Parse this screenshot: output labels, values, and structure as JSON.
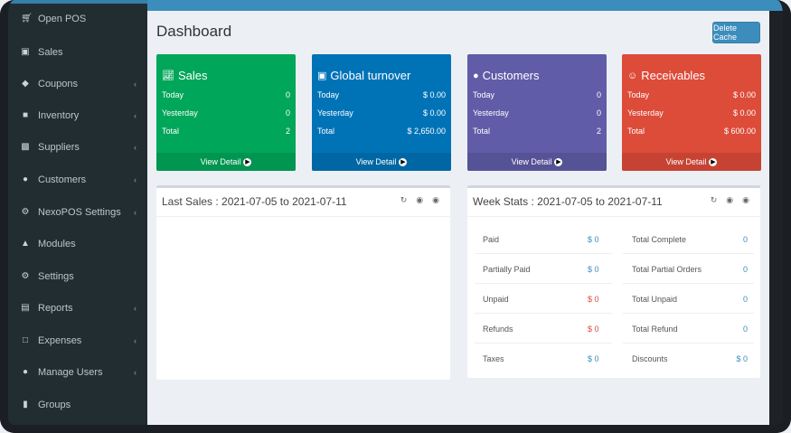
{
  "sidebar": {
    "items": [
      {
        "label": "Open POS",
        "icon": "cart-icon",
        "chevron": false
      },
      {
        "label": "Sales",
        "icon": "basket-icon",
        "chevron": false
      },
      {
        "label": "Coupons",
        "icon": "tag-icon",
        "chevron": true
      },
      {
        "label": "Inventory",
        "icon": "archive-icon",
        "chevron": true
      },
      {
        "label": "Suppliers",
        "icon": "truck-icon",
        "chevron": true
      },
      {
        "label": "Customers",
        "icon": "users-icon",
        "chevron": true
      },
      {
        "label": "NexoPOS Settings",
        "icon": "gear-icon",
        "chevron": true
      },
      {
        "label": "Modules",
        "icon": "puzzle-icon",
        "chevron": false
      },
      {
        "label": "Settings",
        "icon": "cogs-icon",
        "chevron": false
      },
      {
        "label": "Reports",
        "icon": "bar-chart-icon",
        "chevron": true
      },
      {
        "label": "Expenses",
        "icon": "square-icon",
        "chevron": true
      },
      {
        "label": "Manage Users",
        "icon": "users-icon",
        "chevron": true
      },
      {
        "label": "Groups",
        "icon": "shield-icon",
        "chevron": false
      }
    ]
  },
  "header": {
    "title": "Dashboard",
    "delete_cache": "Delete Cache"
  },
  "cards": [
    {
      "title": "Sales",
      "icon": "line-chart-icon",
      "color": "#00a65a",
      "rows": [
        [
          "Today",
          "0"
        ],
        [
          "Yesterday",
          "0"
        ],
        [
          "Total",
          "2"
        ]
      ],
      "footer": "View Detail"
    },
    {
      "title": "Global turnover",
      "icon": "money-icon",
      "color": "#0073b7",
      "rows": [
        [
          "Today",
          "$ 0.00"
        ],
        [
          "Yesterday",
          "$ 0.00"
        ],
        [
          "Total",
          "$ 2,650.00"
        ]
      ],
      "footer": "View Detail"
    },
    {
      "title": "Customers",
      "icon": "users-icon",
      "color": "#605ca8",
      "rows": [
        [
          "Today",
          "0"
        ],
        [
          "Yesterday",
          "0"
        ],
        [
          "Total",
          "2"
        ]
      ],
      "footer": "View Detail"
    },
    {
      "title": "Receivables",
      "icon": "smile-icon",
      "color": "#dd4b39",
      "rows": [
        [
          "Today",
          "$ 0.00"
        ],
        [
          "Yesterday",
          "$ 0.00"
        ],
        [
          "Total",
          "$ 600.00"
        ]
      ],
      "footer": "View Detail"
    }
  ],
  "last_sales": {
    "title": "Last Sales : 2021-07-05 to 2021-07-11"
  },
  "week_stats": {
    "title": "Week Stats : 2021-07-05 to 2021-07-11",
    "left": [
      [
        "Paid",
        "$ 0",
        "#3c8dbc"
      ],
      [
        "Partially Paid",
        "$ 0",
        "#3c8dbc"
      ],
      [
        "Unpaid",
        "$ 0",
        "#dd4b39"
      ],
      [
        "Refunds",
        "$ 0",
        "#dd4b39"
      ],
      [
        "Taxes",
        "$ 0",
        "#3c8dbc"
      ]
    ],
    "right": [
      [
        "Total Complete",
        "0"
      ],
      [
        "Total Partial Orders",
        "0"
      ],
      [
        "Total Unpaid",
        "0"
      ],
      [
        "Total Refund",
        "0"
      ],
      [
        "Discounts",
        "$ 0"
      ]
    ]
  }
}
